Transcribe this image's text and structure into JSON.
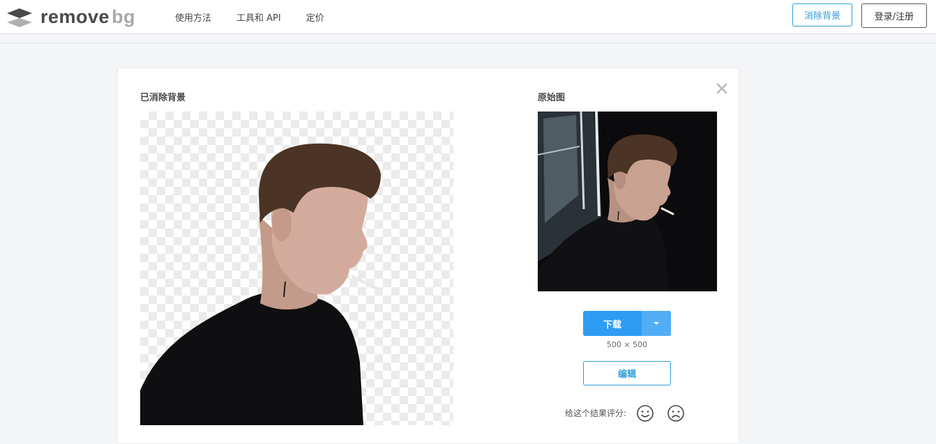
{
  "header": {
    "logo": {
      "remove": "remove",
      "bg": "bg"
    },
    "nav": [
      "使用方法",
      "工具和 API",
      "定价"
    ],
    "remove_bg_button": "消除背景",
    "login_button": "登录/注册"
  },
  "result": {
    "title": "已消除背景"
  },
  "original": {
    "title": "原始图"
  },
  "actions": {
    "download_label": "下载",
    "size_text": "500 × 500",
    "edit_label": "编辑",
    "rate_label": "给这个结果评分:"
  },
  "colors": {
    "accent": "#2e9cf2",
    "accent_border": "#2d9cdb"
  }
}
